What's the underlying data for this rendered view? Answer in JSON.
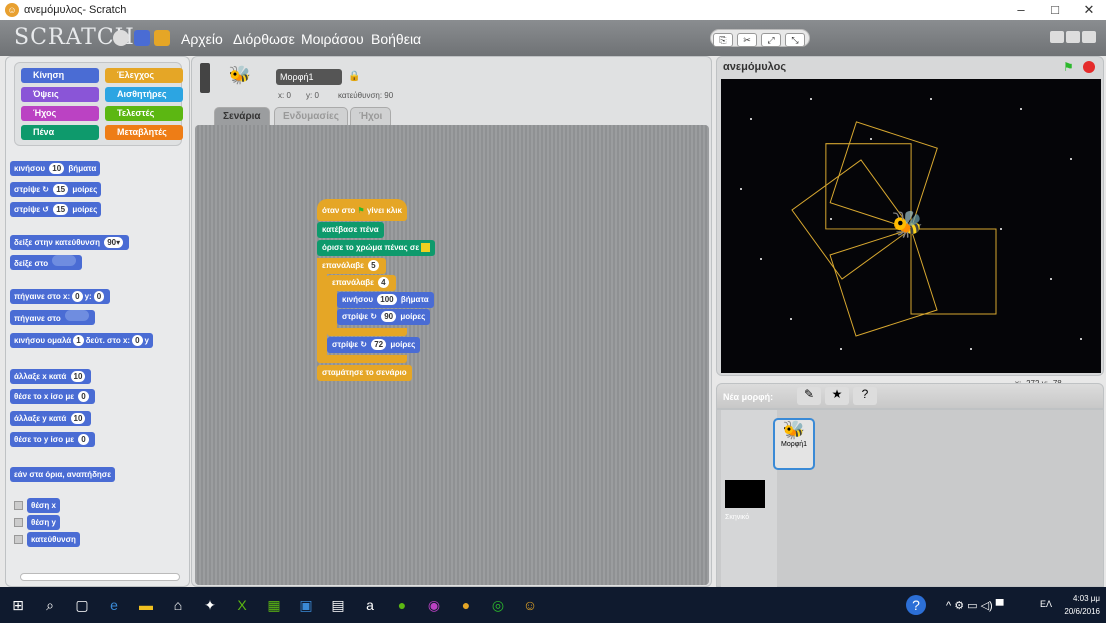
{
  "window": {
    "title": "ανεμόμυλος- Scratch",
    "minimize": "–",
    "maximize": "□",
    "close": "✕"
  },
  "menu": {
    "logo": "SCRATCH",
    "items": [
      "Αρχείο",
      "Διόρθωσε",
      "Μοιράσου",
      "Βοήθεια"
    ]
  },
  "categories": [
    {
      "label": "Κίνηση",
      "color": "#4a6cd4"
    },
    {
      "label": "Έλεγχος",
      "color": "#e5a626"
    },
    {
      "label": "Όψεις",
      "color": "#8a55d7"
    },
    {
      "label": "Αισθητήρες",
      "color": "#2ca5e2"
    },
    {
      "label": "Ήχος",
      "color": "#bb42c3"
    },
    {
      "label": "Τελεστές",
      "color": "#5cb712"
    },
    {
      "label": "Πένα",
      "color": "#0e9a6c"
    },
    {
      "label": "Μεταβλητές",
      "color": "#ee7d16"
    }
  ],
  "palette": {
    "b1": "κινήσου",
    "b1n": "10",
    "b1s": "βήματα",
    "b2": "στρίψε ↻",
    "b2n": "15",
    "b2s": "μοίρες",
    "b3": "στρίψε ↺",
    "b3n": "15",
    "b3s": "μοίρες",
    "b4": "δείξε στην κατεύθυνση",
    "b4n": "90▾",
    "b5": "δείξε στο",
    "b6": "πήγαινε στο x:",
    "b6n": "0",
    "b6y": "y:",
    "b6yn": "0",
    "b7": "πήγαινε στο",
    "b8": "κινήσου ομαλά",
    "b8n": "1",
    "b8s": "δεύτ. στο x:",
    "b8xn": "0",
    "b8y": "y",
    "b9": "άλλαξε x κατά",
    "b9n": "10",
    "b10": "θέσε το x ίσο με",
    "b10n": "0",
    "b11": "άλλαξε y κατά",
    "b11n": "10",
    "b12": "θέσε το y ίσο με",
    "b12n": "0",
    "b13": "εάν στα όρια, αναπήδησε",
    "r1": "θέση x",
    "r2": "θέση y",
    "r3": "κατεύθυνση"
  },
  "sprite": {
    "name": "Μορφή1",
    "x": "x: 0",
    "y": "y: 0",
    "dir": "κατεύθυνση: 90"
  },
  "tabs": [
    "Σενάρια",
    "Ενδυμασίες",
    "Ήχοι"
  ],
  "script": {
    "hat": "όταν στο",
    "hat2": "γίνει κλικ",
    "pendown": "κατέβασε πένα",
    "pencolor": "όρισε το χρώμα πένας σε",
    "repeat1": "επανάλαβε",
    "repeat1n": "5",
    "repeat2": "επανάλαβε",
    "repeat2n": "4",
    "move": "κινήσου",
    "moven": "100",
    "moves": "βήματα",
    "turn": "στρίψε ↻",
    "turnn": "90",
    "turns": "μοίρες",
    "turn2": "στρίψε ↻",
    "turn2n": "72",
    "turn2s": "μοίρες",
    "stop": "σταμάτησε το σενάριο"
  },
  "stage": {
    "title": "ανεμόμυλος",
    "mouse_x": "x: -272",
    "mouse_y": "y: -78"
  },
  "sprites": {
    "new_label": "Νέα μορφή:",
    "stage_label": "Σκηνικό",
    "sprite_label": "Μορφή1"
  },
  "taskbar": {
    "lang": "ΕΛ",
    "time": "4:03 μμ",
    "date": "20/6/2016"
  }
}
